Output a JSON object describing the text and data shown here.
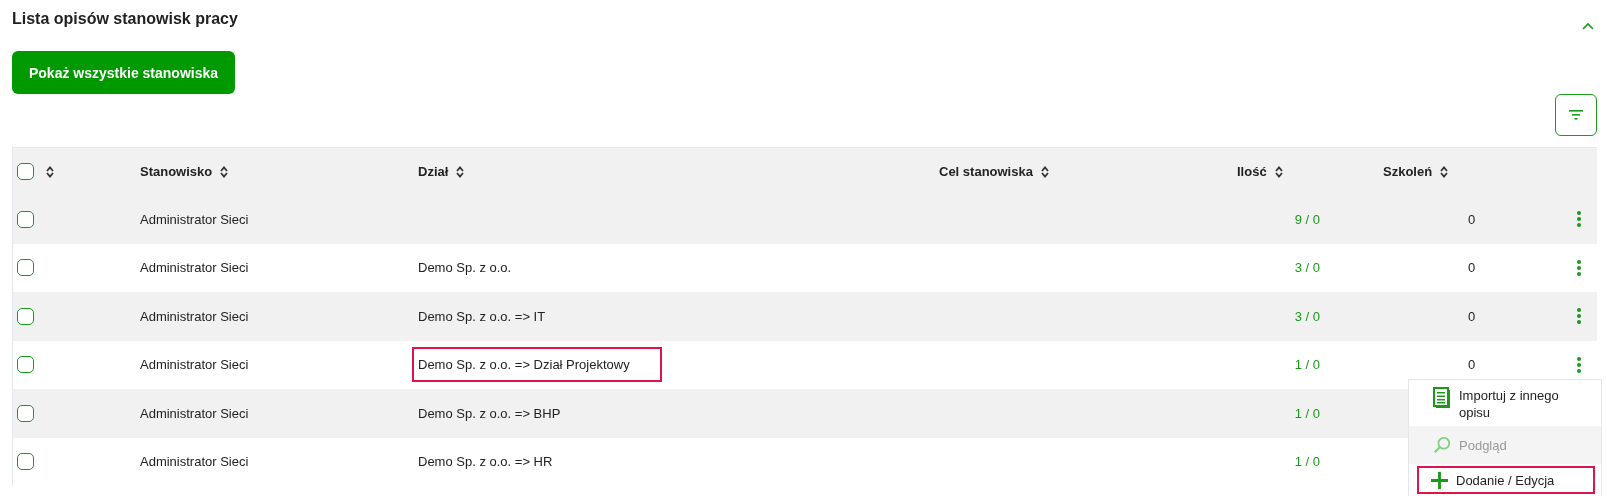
{
  "section": {
    "title": "Lista opisów stanowisk pracy",
    "expanded": true
  },
  "show_all_button": "Pokaż wszystkie stanowiska",
  "table": {
    "select_all": {
      "checked": false
    },
    "columns": [
      {
        "label": "Stanowisko"
      },
      {
        "label": "Dział"
      },
      {
        "label": "Cel stanowiska"
      },
      {
        "label": "Ilość"
      },
      {
        "label": "Szkoleń"
      }
    ],
    "rows": [
      {
        "checked": false,
        "stanowisko": "Administrator Sieci",
        "dzial": "",
        "ilosc": "9 / 0",
        "szkolen": "0"
      },
      {
        "checked": false,
        "stanowisko": "Administrator Sieci",
        "dzial": "Demo Sp. z o.o.",
        "ilosc": "3 / 0",
        "szkolen": "0"
      },
      {
        "checked": false,
        "stanowisko": "Administrator Sieci",
        "dzial": "Demo Sp. z o.o. => IT",
        "ilosc": "3 / 0",
        "szkolen": "0"
      },
      {
        "checked": false,
        "stanowisko": "Administrator Sieci",
        "dzial": "Demo Sp. z o.o. => Dział Projektowy",
        "ilosc": "1 / 0",
        "szkolen": "0",
        "highlighted": true
      },
      {
        "checked": false,
        "stanowisko": "Administrator Sieci",
        "dzial": "Demo Sp. z o.o. => BHP",
        "ilosc": "1 / 0"
      },
      {
        "checked": false,
        "stanowisko": "Administrator Sieci",
        "dzial": "Demo Sp. z o.o. => HR",
        "ilosc": "1 / 0"
      }
    ]
  },
  "context_menu": {
    "items": [
      {
        "kind": "import",
        "label": "Importuj z innego opisu",
        "disabled": false,
        "highlighted": false
      },
      {
        "kind": "preview",
        "label": "Podgląd",
        "disabled": true,
        "highlighted": false
      },
      {
        "kind": "add",
        "label": "Dodanie / Edycja",
        "disabled": false,
        "highlighted": true
      }
    ]
  }
}
